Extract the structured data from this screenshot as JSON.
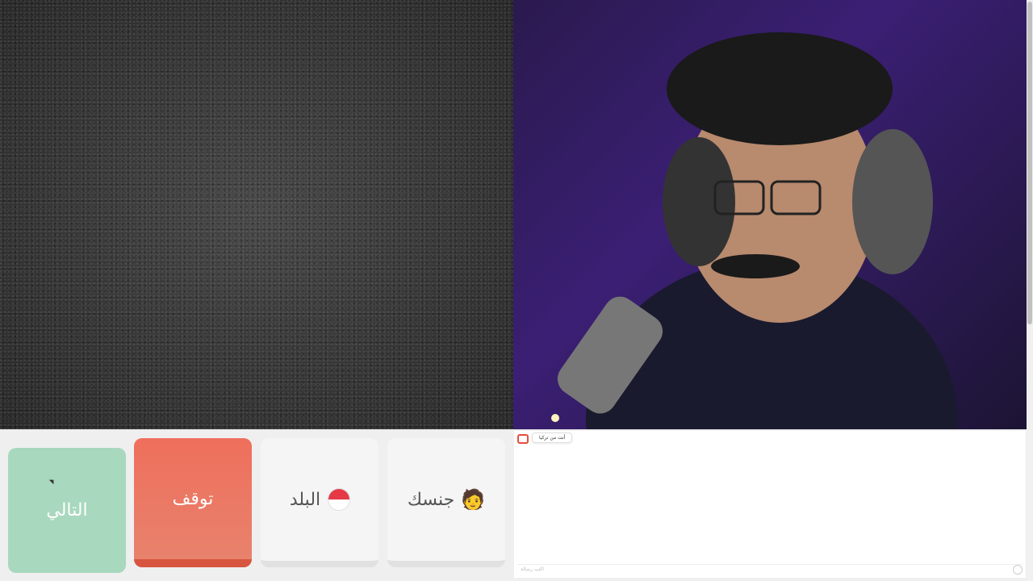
{
  "controls": {
    "next_label": "التالي",
    "stop_label": "توقف",
    "country_label": "البلد",
    "gender_label": "جنسك"
  },
  "icons": {
    "country_flag": "flag-icon",
    "gender": "person-icon"
  },
  "chat": {
    "status_message": "أنت من تركيا",
    "input_placeholder": "اكتب رسالة"
  },
  "colors": {
    "next": "#a8d8bd",
    "stop": "#ee6f5c",
    "neutral": "#f5f5f5"
  }
}
